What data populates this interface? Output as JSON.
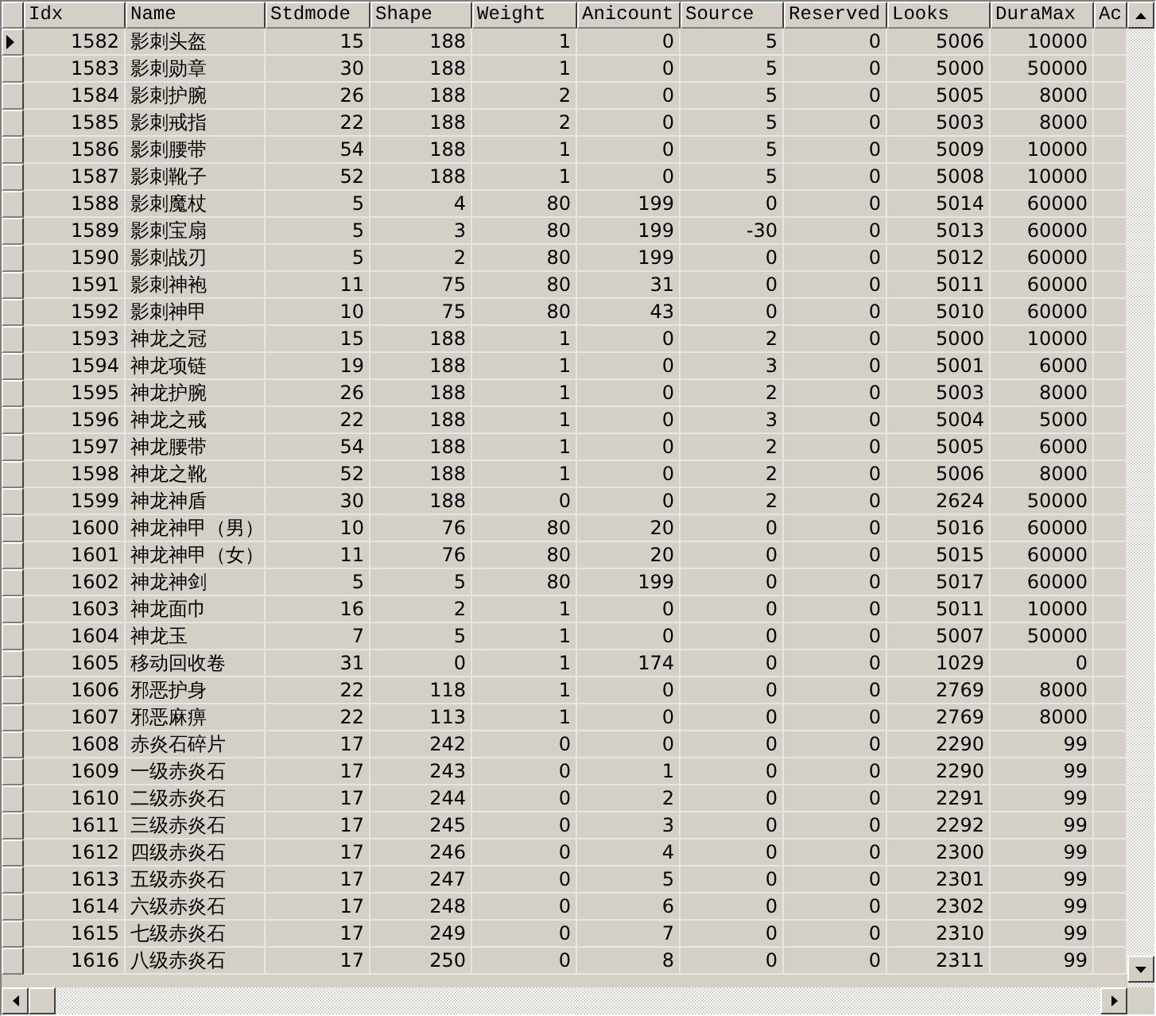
{
  "columns": [
    {
      "label": "Idx",
      "kind": "number"
    },
    {
      "label": "Name",
      "kind": "text"
    },
    {
      "label": "Stdmode",
      "kind": "number"
    },
    {
      "label": "Shape",
      "kind": "number"
    },
    {
      "label": "Weight",
      "kind": "number"
    },
    {
      "label": "Anicount",
      "kind": "number"
    },
    {
      "label": "Source",
      "kind": "number"
    },
    {
      "label": "Reserved",
      "kind": "number"
    },
    {
      "label": "Looks",
      "kind": "number"
    },
    {
      "label": "DuraMax",
      "kind": "number"
    },
    {
      "label": "Ac"
    }
  ],
  "rows": [
    {
      "selected": true,
      "cells": [
        "1582",
        "影刺头盔",
        "15",
        "188",
        "1",
        "0",
        "5",
        "0",
        "5006",
        "10000"
      ]
    },
    {
      "selected": false,
      "cells": [
        "1583",
        "影刺勋章",
        "30",
        "188",
        "1",
        "0",
        "5",
        "0",
        "5000",
        "50000"
      ]
    },
    {
      "selected": false,
      "cells": [
        "1584",
        "影刺护腕",
        "26",
        "188",
        "2",
        "0",
        "5",
        "0",
        "5005",
        "8000"
      ]
    },
    {
      "selected": false,
      "cells": [
        "1585",
        "影刺戒指",
        "22",
        "188",
        "2",
        "0",
        "5",
        "0",
        "5003",
        "8000"
      ]
    },
    {
      "selected": false,
      "cells": [
        "1586",
        "影刺腰带",
        "54",
        "188",
        "1",
        "0",
        "5",
        "0",
        "5009",
        "10000"
      ]
    },
    {
      "selected": false,
      "cells": [
        "1587",
        "影刺靴子",
        "52",
        "188",
        "1",
        "0",
        "5",
        "0",
        "5008",
        "10000"
      ]
    },
    {
      "selected": false,
      "cells": [
        "1588",
        "影刺魔杖",
        "5",
        "4",
        "80",
        "199",
        "0",
        "0",
        "5014",
        "60000"
      ]
    },
    {
      "selected": false,
      "cells": [
        "1589",
        "影刺宝扇",
        "5",
        "3",
        "80",
        "199",
        "-30",
        "0",
        "5013",
        "60000"
      ]
    },
    {
      "selected": false,
      "cells": [
        "1590",
        "影刺战刃",
        "5",
        "2",
        "80",
        "199",
        "0",
        "0",
        "5012",
        "60000"
      ]
    },
    {
      "selected": false,
      "cells": [
        "1591",
        "影刺神袍",
        "11",
        "75",
        "80",
        "31",
        "0",
        "0",
        "5011",
        "60000"
      ]
    },
    {
      "selected": false,
      "cells": [
        "1592",
        "影刺神甲",
        "10",
        "75",
        "80",
        "43",
        "0",
        "0",
        "5010",
        "60000"
      ]
    },
    {
      "selected": false,
      "cells": [
        "1593",
        "神龙之冠",
        "15",
        "188",
        "1",
        "0",
        "2",
        "0",
        "5000",
        "10000"
      ]
    },
    {
      "selected": false,
      "cells": [
        "1594",
        "神龙项链",
        "19",
        "188",
        "1",
        "0",
        "3",
        "0",
        "5001",
        "6000"
      ]
    },
    {
      "selected": false,
      "cells": [
        "1595",
        "神龙护腕",
        "26",
        "188",
        "1",
        "0",
        "2",
        "0",
        "5003",
        "8000"
      ]
    },
    {
      "selected": false,
      "cells": [
        "1596",
        "神龙之戒",
        "22",
        "188",
        "1",
        "0",
        "3",
        "0",
        "5004",
        "5000"
      ]
    },
    {
      "selected": false,
      "cells": [
        "1597",
        "神龙腰带",
        "54",
        "188",
        "1",
        "0",
        "2",
        "0",
        "5005",
        "6000"
      ]
    },
    {
      "selected": false,
      "cells": [
        "1598",
        "神龙之靴",
        "52",
        "188",
        "1",
        "0",
        "2",
        "0",
        "5006",
        "8000"
      ]
    },
    {
      "selected": false,
      "cells": [
        "1599",
        "神龙神盾",
        "30",
        "188",
        "0",
        "0",
        "2",
        "0",
        "2624",
        "50000"
      ]
    },
    {
      "selected": false,
      "cells": [
        "1600",
        "神龙神甲（男）",
        "10",
        "76",
        "80",
        "20",
        "0",
        "0",
        "5016",
        "60000"
      ]
    },
    {
      "selected": false,
      "cells": [
        "1601",
        "神龙神甲（女）",
        "11",
        "76",
        "80",
        "20",
        "0",
        "0",
        "5015",
        "60000"
      ]
    },
    {
      "selected": false,
      "cells": [
        "1602",
        "神龙神剑",
        "5",
        "5",
        "80",
        "199",
        "0",
        "0",
        "5017",
        "60000"
      ]
    },
    {
      "selected": false,
      "cells": [
        "1603",
        "神龙面巾",
        "16",
        "2",
        "1",
        "0",
        "0",
        "0",
        "5011",
        "10000"
      ]
    },
    {
      "selected": false,
      "cells": [
        "1604",
        "神龙玉",
        "7",
        "5",
        "1",
        "0",
        "0",
        "0",
        "5007",
        "50000"
      ]
    },
    {
      "selected": false,
      "cells": [
        "1605",
        "移动回收卷",
        "31",
        "0",
        "1",
        "174",
        "0",
        "0",
        "1029",
        "0"
      ]
    },
    {
      "selected": false,
      "cells": [
        "1606",
        "邪恶护身",
        "22",
        "118",
        "1",
        "0",
        "0",
        "0",
        "2769",
        "8000"
      ]
    },
    {
      "selected": false,
      "cells": [
        "1607",
        "邪恶麻痹",
        "22",
        "113",
        "1",
        "0",
        "0",
        "0",
        "2769",
        "8000"
      ]
    },
    {
      "selected": false,
      "cells": [
        "1608",
        "赤炎石碎片",
        "17",
        "242",
        "0",
        "0",
        "0",
        "0",
        "2290",
        "99"
      ]
    },
    {
      "selected": false,
      "cells": [
        "1609",
        "一级赤炎石",
        "17",
        "243",
        "0",
        "1",
        "0",
        "0",
        "2290",
        "99"
      ]
    },
    {
      "selected": false,
      "cells": [
        "1610",
        "二级赤炎石",
        "17",
        "244",
        "0",
        "2",
        "0",
        "0",
        "2291",
        "99"
      ]
    },
    {
      "selected": false,
      "cells": [
        "1611",
        "三级赤炎石",
        "17",
        "245",
        "0",
        "3",
        "0",
        "0",
        "2292",
        "99"
      ]
    },
    {
      "selected": false,
      "cells": [
        "1612",
        "四级赤炎石",
        "17",
        "246",
        "0",
        "4",
        "0",
        "0",
        "2300",
        "99"
      ]
    },
    {
      "selected": false,
      "cells": [
        "1613",
        "五级赤炎石",
        "17",
        "247",
        "0",
        "5",
        "0",
        "0",
        "2301",
        "99"
      ]
    },
    {
      "selected": false,
      "cells": [
        "1614",
        "六级赤炎石",
        "17",
        "248",
        "0",
        "6",
        "0",
        "0",
        "2302",
        "99"
      ]
    },
    {
      "selected": false,
      "cells": [
        "1615",
        "七级赤炎石",
        "17",
        "249",
        "0",
        "7",
        "0",
        "0",
        "2310",
        "99"
      ]
    },
    {
      "selected": false,
      "cells": [
        "1616",
        "八级赤炎石",
        "17",
        "250",
        "0",
        "8",
        "0",
        "0",
        "2311",
        "99"
      ]
    }
  ]
}
